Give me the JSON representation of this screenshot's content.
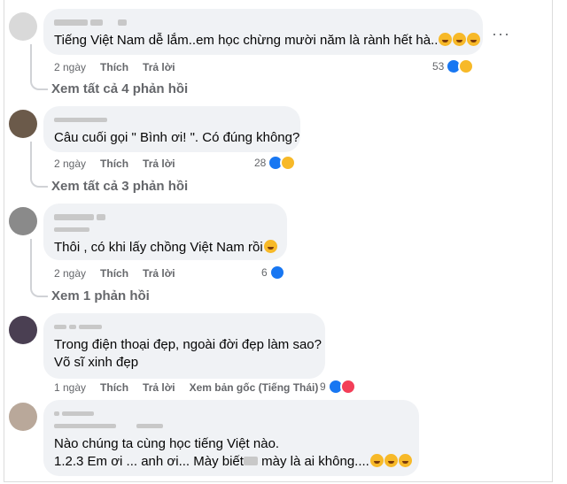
{
  "comments": [
    {
      "text_lines": [
        "Tiếng Việt Nam dễ lắm..em học chừng mười năm là rành hết hà.."
      ],
      "time": "2 ngày",
      "like": "Thích",
      "reply": "Trả lời",
      "count": "53",
      "replies": "Xem tất cả 4 phản hồi"
    },
    {
      "text_lines": [
        "Câu cuối gọi \" Bình ơi! \". Có đúng không?"
      ],
      "time": "2 ngày",
      "like": "Thích",
      "reply": "Trả lời",
      "count": "28",
      "replies": "Xem tất cả 3 phản hồi"
    },
    {
      "text_lines": [
        "Thôi , có khi lấy chồng Việt Nam rồi"
      ],
      "time": "2 ngày",
      "like": "Thích",
      "reply": "Trả lời",
      "count": "6",
      "replies": "Xem 1 phản hồi"
    },
    {
      "text_lines": [
        "Trong điện thoại đẹp, ngoài đời đẹp làm sao?",
        "Võ sĩ xinh đẹp"
      ],
      "time": "1 ngày",
      "like": "Thích",
      "reply": "Trả lời",
      "see_original": "Xem bản gốc (Tiếng Thái)",
      "count": "9"
    },
    {
      "text_lines": [
        "Nào chúng ta cùng học tiếng Việt nào.",
        "1.2.3 Em ơi ... anh ơi... Mày biết",
        " mày là ai không...."
      ]
    }
  ],
  "more_menu": "···"
}
